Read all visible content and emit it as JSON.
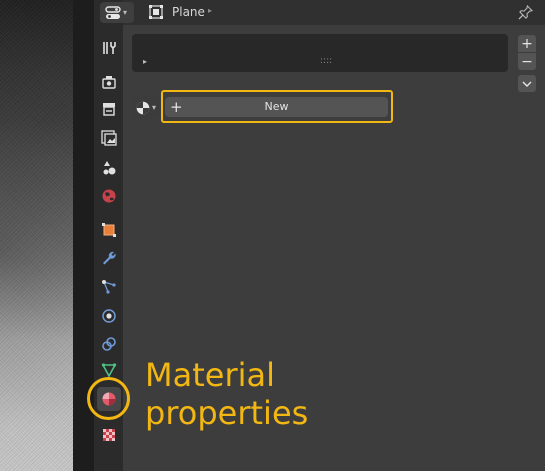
{
  "header": {
    "breadcrumb_label": "Plane"
  },
  "tabs": [
    {
      "name": "tool",
      "icon": "tool-icon"
    },
    {
      "name": "render",
      "icon": "render-icon"
    },
    {
      "name": "output",
      "icon": "output-icon"
    },
    {
      "name": "view-layer",
      "icon": "view-layer-icon"
    },
    {
      "name": "scene",
      "icon": "scene-icon"
    },
    {
      "name": "world",
      "icon": "world-icon"
    },
    {
      "name": "object",
      "icon": "object-icon"
    },
    {
      "name": "modifiers",
      "icon": "wrench-icon"
    },
    {
      "name": "particles",
      "icon": "particles-icon"
    },
    {
      "name": "physics",
      "icon": "physics-icon"
    },
    {
      "name": "constraints",
      "icon": "constraints-icon"
    },
    {
      "name": "data",
      "icon": "mesh-data-icon"
    },
    {
      "name": "material",
      "icon": "material-icon",
      "active": true
    },
    {
      "name": "texture",
      "icon": "texture-icon"
    }
  ],
  "material": {
    "new_button_label": "New",
    "new_button_icon": "+",
    "slot_add_label": "+",
    "slot_remove_label": "−",
    "expand_glyph": "▸",
    "grip_glyph": "::::"
  },
  "annotation": {
    "line1": "Material",
    "line2": "properties",
    "color": "#f2b712"
  },
  "colors": {
    "accent_annotation": "#f2b712",
    "panel_bg": "#3d3d3d",
    "tabbar_bg": "#2b2b2b",
    "button_bg": "#545454"
  }
}
